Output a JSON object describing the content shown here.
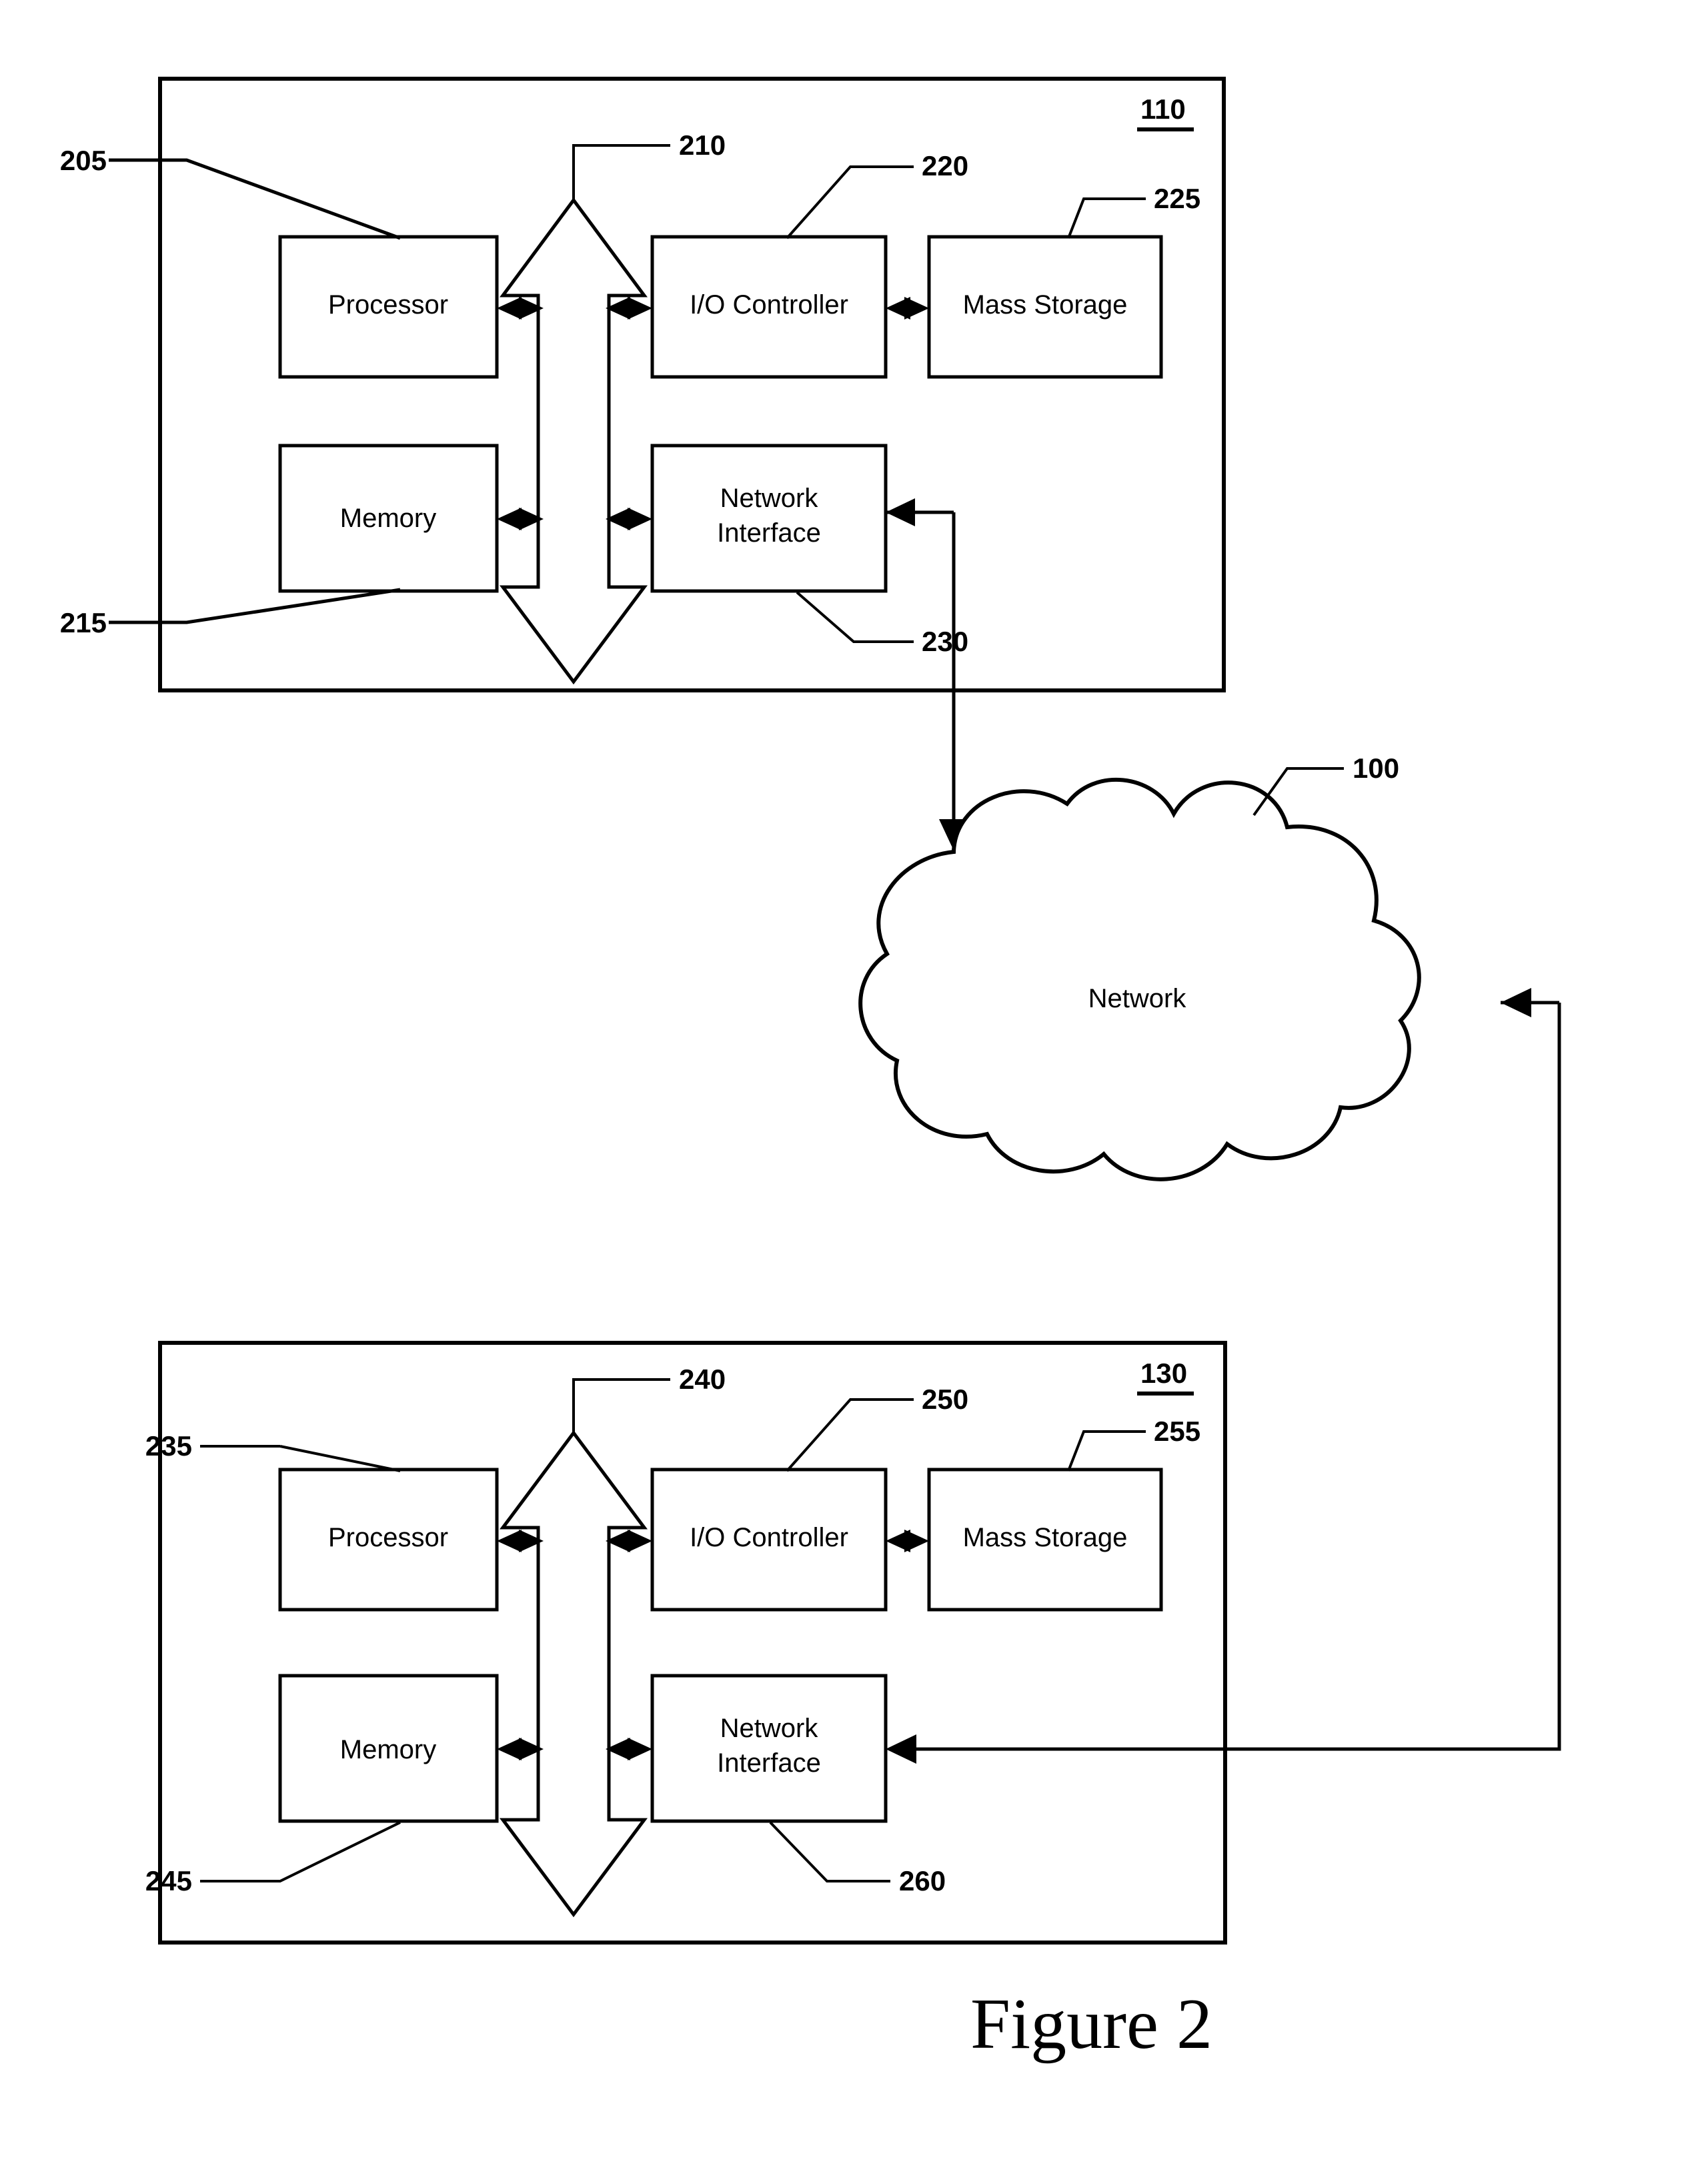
{
  "figure": {
    "caption": "Figure 2",
    "title": "Figure 2"
  },
  "systems": [
    {
      "id": "top-system",
      "ref": "110",
      "bus": {
        "ref": "210"
      },
      "leaders": [
        {
          "ref": "205",
          "target": "processor"
        },
        {
          "ref": "215",
          "target": "memory"
        },
        {
          "ref": "220",
          "target": "io-controller"
        },
        {
          "ref": "225",
          "target": "mass-storage"
        },
        {
          "ref": "230",
          "target": "network-interface"
        }
      ],
      "blocks": [
        {
          "name": "processor",
          "label": "Processor",
          "lines": [
            "Processor"
          ]
        },
        {
          "name": "io-controller",
          "label": "I/O Controller",
          "lines": [
            "I/O Controller"
          ]
        },
        {
          "name": "mass-storage",
          "label": "Mass Storage",
          "lines": [
            "Mass Storage"
          ]
        },
        {
          "name": "memory",
          "label": "Memory",
          "lines": [
            "Memory"
          ]
        },
        {
          "name": "network-interface",
          "label": "Network Interface",
          "lines": [
            "Network",
            "Interface"
          ]
        }
      ]
    },
    {
      "id": "bottom-system",
      "ref": "130",
      "bus": {
        "ref": "240"
      },
      "leaders": [
        {
          "ref": "235",
          "target": "processor"
        },
        {
          "ref": "245",
          "target": "memory"
        },
        {
          "ref": "250",
          "target": "io-controller"
        },
        {
          "ref": "255",
          "target": "mass-storage"
        },
        {
          "ref": "260",
          "target": "network-interface"
        }
      ],
      "blocks": [
        {
          "name": "processor",
          "label": "Processor",
          "lines": [
            "Processor"
          ]
        },
        {
          "name": "io-controller",
          "label": "I/O Controller",
          "lines": [
            "I/O Controller"
          ]
        },
        {
          "name": "mass-storage",
          "label": "Mass Storage",
          "lines": [
            "Mass Storage"
          ]
        },
        {
          "name": "memory",
          "label": "Memory",
          "lines": [
            "Memory"
          ]
        },
        {
          "name": "network-interface",
          "label": "Network Interface",
          "lines": [
            "Network",
            "Interface"
          ]
        }
      ]
    }
  ],
  "network": {
    "label": "Network",
    "ref": "100"
  },
  "top": {
    "ref": "110",
    "bus_ref": "210",
    "processor_label": "Processor",
    "processor_ref": "205",
    "memory_label": "Memory",
    "memory_ref": "215",
    "io_label": "I/O Controller",
    "io_ref": "220",
    "storage_label": "Mass Storage",
    "storage_ref": "225",
    "ni_line1": "Network",
    "ni_line2": "Interface",
    "ni_ref": "230"
  },
  "bottom": {
    "ref": "130",
    "bus_ref": "240",
    "processor_label": "Processor",
    "processor_ref": "235",
    "memory_label": "Memory",
    "memory_ref": "245",
    "io_label": "I/O Controller",
    "io_ref": "250",
    "storage_label": "Mass Storage",
    "storage_ref": "255",
    "ni_line1": "Network",
    "ni_line2": "Interface",
    "ni_ref": "260"
  },
  "colors": {
    "ink": "#000000",
    "paper": "#ffffff"
  }
}
